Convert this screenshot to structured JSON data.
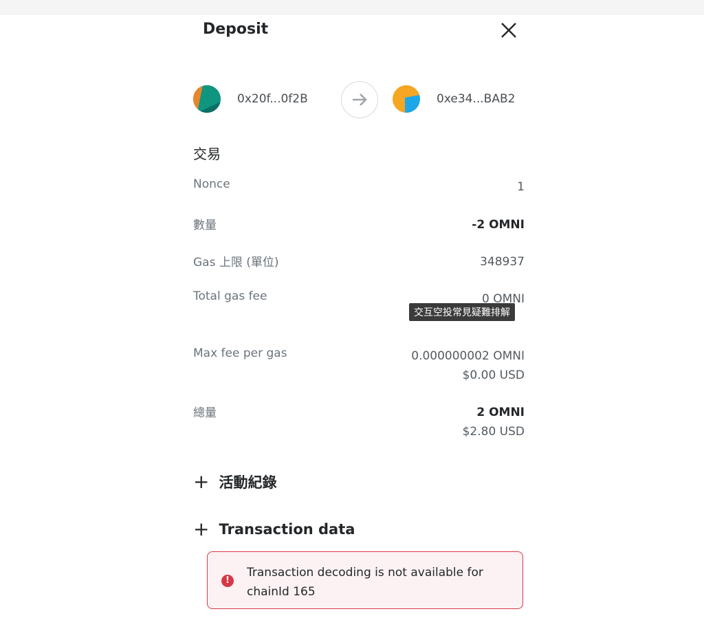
{
  "header": {
    "title": "Deposit",
    "close_icon": "close-icon"
  },
  "from": {
    "address": "0x20f...0f2B",
    "avatar_colors": [
      "#0d8a7a",
      "#e8862a"
    ]
  },
  "to": {
    "address": "0xe34...BAB2",
    "avatar_colors": [
      "#f5a623",
      "#1ea7e8"
    ]
  },
  "section_title": "交易",
  "rows": [
    {
      "label": "Nonce",
      "value": "1"
    },
    {
      "label": "數量",
      "value": "-2 OMNI"
    },
    {
      "label": "Gas 上限 (單位)",
      "value": "348937"
    },
    {
      "label": "Total gas fee",
      "value": "0 OMNI"
    },
    {
      "label": "Max fee per gas",
      "value": "0.000000002 OMNI",
      "sub": "$0.00 USD"
    },
    {
      "label": "總量",
      "value": "2 OMNI",
      "sub": "$2.80 USD"
    }
  ],
  "tooltip": "交互空投常見疑難排解",
  "expanders": [
    {
      "label": "活動紀錄"
    },
    {
      "label": "Transaction data"
    }
  ],
  "error": {
    "message": "Transaction decoding is not available for chainId 165",
    "color": "#d73847"
  }
}
